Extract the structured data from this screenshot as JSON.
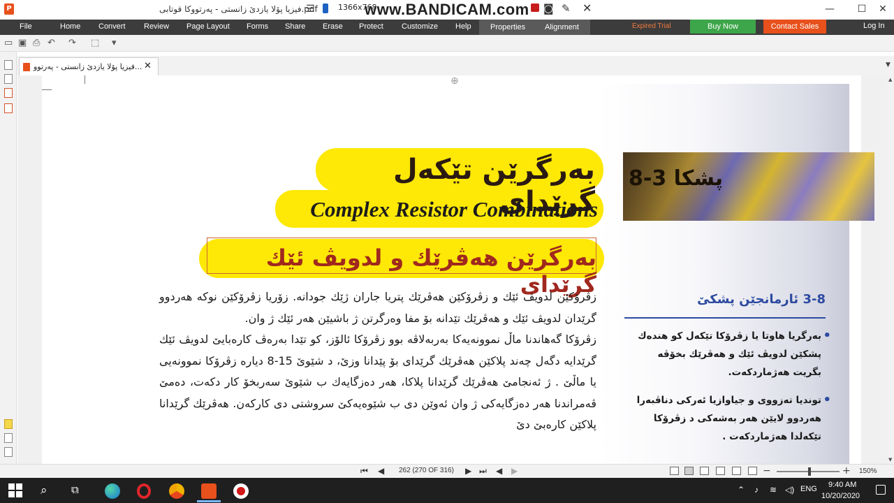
{
  "window": {
    "title": "فیزیا پۆلا یازدێ زانستی - پەرتووکا قوتابی.pdf",
    "recorder": {
      "resolution": "1366x768",
      "watermark": "www.BANDICAM.com"
    }
  },
  "menu": {
    "items": [
      "File",
      "Home",
      "Convert",
      "Review",
      "Page Layout",
      "Forms",
      "Share",
      "Erase",
      "Protect",
      "Customize",
      "Help",
      "Properties",
      "Alignment"
    ],
    "trial_label": "Expired Trial",
    "buy_label": "Buy Now",
    "sales_label": "Contact Sales",
    "login_label": "Log In"
  },
  "tab": {
    "label": "فیزیا پۆلا یازدێ زانستی - پەرتوو..."
  },
  "document": {
    "title_ku": "بەرگرێن تێکەل گرێدای",
    "title_en": "Complex Resistor Combinations",
    "subtitle_ku": "بەرگرێن هەڤرێك و لدویڤ ئێك گرێدای",
    "paragraph1": "زڤرۆکێن لدویڤ ئێك و زڤرۆکێن هەڤرێك پتریا جاران ژێك جودانە. زۆریا زڤرۆکێن نوکە هەردوو گرێدان لدویڤ ئێك و هەڤرێك تێدانە بۆ مفا وەرگرتن ژ باشیێن هەر ئێك ژ وان.",
    "paragraph2": "زڤرۆکا گەهاندنا ماڵ نموونەیەکا بەربەلاڤە بوو زڤرۆکا ئالۆز، کو تێدا بەرەڤ کارەبایێ لدویڤ ئێك گرێدایە دگەل چەند پلاکێن هەڤرێك گرێدای بۆ پێدانا وزێ، د شێوێ 15-8 دیارە زڤرۆکا نموونەیی یا ماڵێ . ژ ئەنجامێ هەڤرێك گرێدانا پلاکا، هەر دەزگایەك ب شێوێ سەربخۆ کار دکەت، دەمێ ڤەمراندنا هەر دەزگایەکی ژ وان ئەوێن دی ب شێوەیەکێ سروشتی دی کارکەن. هەڤرێك گرێدانا پلاکێن کارەبێ دێ"
  },
  "section": {
    "label": "پشکا 3-8",
    "objectives_title": "3-8 ئارمانجێن پشکێ",
    "objectives": [
      "بەرگریا هاوتا یا زڤرۆکا تێکەل کو هندەك پشکێن لدویڤ ئێك و هەڤرێك بخۆڤە بگریت هەژماردکەت.",
      "توندیا تەزووی و جیاوازیا ئەرکی دناڤبەرا هەردوو لایێن هەر بەشەکی د زڤرۆکا تێکەلدا هەژماردکەت ."
    ]
  },
  "statusbar": {
    "page_indicator": "262 (270 OF 316)",
    "zoom_level": "150%"
  },
  "taskbar": {
    "lang": "ENG",
    "time": "9:40 AM",
    "date": "10/20/2020"
  },
  "colors": {
    "ribbon": "#3c3c3c",
    "accent_orange": "#e8501c",
    "buy_green": "#3ea64a",
    "title_yellow": "#fde806",
    "subtitle_red": "#a0281e",
    "objective_blue": "#2c4aa0"
  }
}
